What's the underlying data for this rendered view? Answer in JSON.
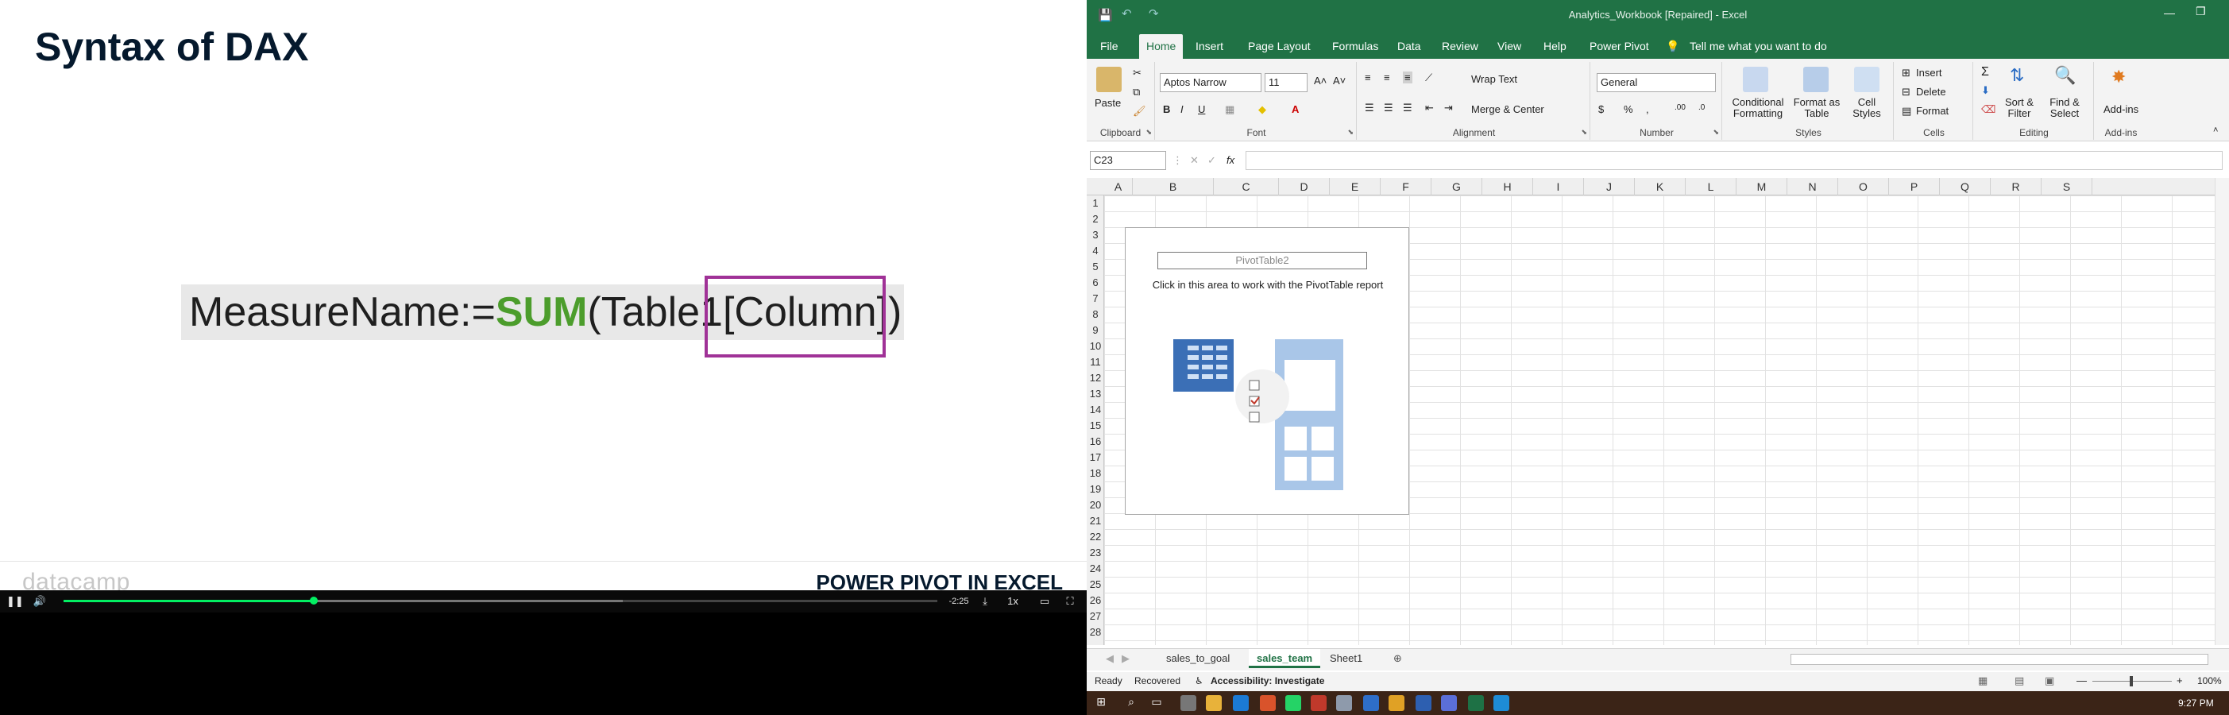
{
  "slide": {
    "title": "Syntax of DAX",
    "formula_prefix": "MeasureName:=",
    "formula_function": "SUM",
    "formula_rest": "(Table1[Column])",
    "logo": "datacamp",
    "footer": "POWER PIVOT IN EXCEL"
  },
  "player": {
    "time_remaining": "-2:25",
    "speed": "1x",
    "progress_fraction": 0.286,
    "buffered_fraction": 0.64
  },
  "excel": {
    "window_title": "Analytics_Workbook [Repaired]  -  Excel",
    "ribbon_tabs": [
      "File",
      "Home",
      "Insert",
      "Page Layout",
      "Formulas",
      "Data",
      "Review",
      "View",
      "Help",
      "Power Pivot"
    ],
    "active_tab": "Home",
    "tell_me": "Tell me what you want to do",
    "clipboard": {
      "paste": "Paste",
      "label": "Clipboard"
    },
    "font": {
      "name": "Aptos Narrow",
      "size": "11",
      "label": "Font"
    },
    "alignment": {
      "wrap": "Wrap Text",
      "merge": "Merge & Center",
      "label": "Alignment"
    },
    "number": {
      "format": "General",
      "label": "Number"
    },
    "styles": {
      "conditional": "Conditional Formatting",
      "table": "Format as Table",
      "cell": "Cell Styles",
      "label": "Styles"
    },
    "cells": {
      "insert": "Insert",
      "delete": "Delete",
      "format": "Format",
      "label": "Cells"
    },
    "editing": {
      "sort": "Sort & Filter",
      "find": "Find & Select",
      "label": "Editing"
    },
    "addins": {
      "btn": "Add-ins",
      "label": "Add-ins"
    },
    "name_box": "C23",
    "fx": "fx",
    "columns": [
      "A",
      "B",
      "C",
      "D",
      "E",
      "F",
      "G",
      "H",
      "I",
      "J",
      "K",
      "L",
      "M",
      "N",
      "O",
      "P",
      "Q",
      "R",
      "S"
    ],
    "rows": [
      "1",
      "2",
      "3",
      "4",
      "5",
      "6",
      "7",
      "8",
      "9",
      "10",
      "11",
      "12",
      "13",
      "14",
      "15",
      "16",
      "17",
      "18",
      "19",
      "20",
      "21",
      "22",
      "23",
      "24",
      "25",
      "26",
      "27",
      "28"
    ],
    "pivot": {
      "name": "PivotTable2",
      "message": "Click in this area to work with the PivotTable report"
    },
    "sheets": [
      "sales_to_goal",
      "sales_team",
      "Sheet1"
    ],
    "active_sheet": "sales_team",
    "status": {
      "ready": "Ready",
      "recovered": "Recovered",
      "accessibility": "Accessibility: Investigate",
      "zoom": "100%"
    },
    "clock": "9:27 PM"
  }
}
